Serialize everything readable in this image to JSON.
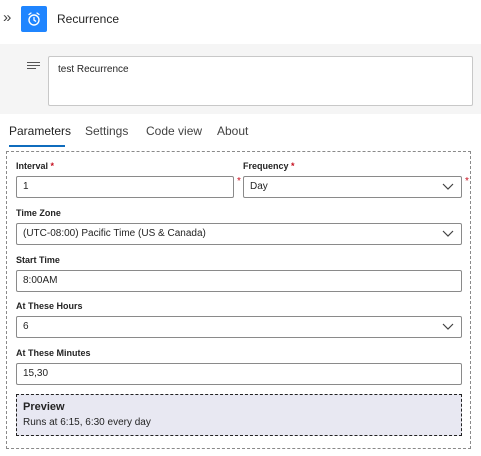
{
  "header": {
    "title": "Recurrence",
    "collapse_glyph": "»",
    "icon": "alarm-clock-icon",
    "icon_color": "#1f85ff"
  },
  "description": {
    "value": "test Recurrence",
    "icon": "text-lines-icon"
  },
  "tabs": [
    {
      "label": "Parameters",
      "active": true
    },
    {
      "label": "Settings",
      "active": false
    },
    {
      "label": "Code view",
      "active": false
    },
    {
      "label": "About",
      "active": false
    }
  ],
  "form": {
    "interval": {
      "label": "Interval",
      "required_mark": "*",
      "value": "1"
    },
    "frequency": {
      "label": "Frequency",
      "required_mark": "*",
      "value": "Day"
    },
    "time_zone": {
      "label": "Time Zone",
      "value": "(UTC-08:00) Pacific Time (US & Canada)"
    },
    "start_time": {
      "label": "Start Time",
      "value": "8:00AM"
    },
    "at_these_hours": {
      "label": "At These Hours",
      "value": "6"
    },
    "at_these_minutes": {
      "label": "At These Minutes",
      "value": "15,30"
    }
  },
  "preview": {
    "title": "Preview",
    "text": "Runs at 6:15, 6:30 every day"
  },
  "colors": {
    "accent": "#0f6cbd",
    "required": "#c50f1f",
    "preview_bg": "#e8e8f2"
  }
}
